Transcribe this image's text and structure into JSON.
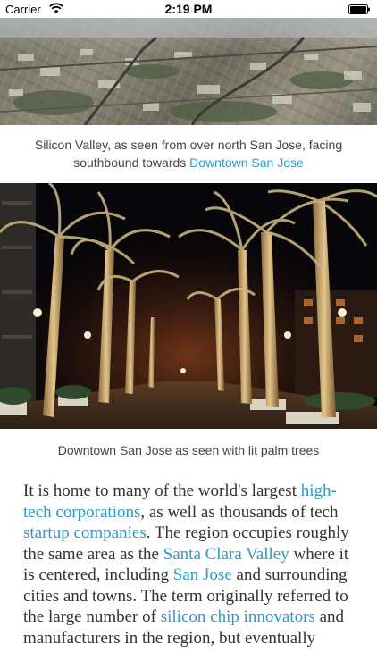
{
  "status_bar": {
    "carrier": "Carrier",
    "time": "2:19 PM"
  },
  "figure1": {
    "caption_text": "Silicon Valley, as seen from over north San Jose, facing southbound towards ",
    "caption_link": "Downtown San Jose"
  },
  "figure2": {
    "caption": "Downtown San Jose as seen with lit palm trees"
  },
  "article": {
    "t1": "It is home to many of the world's largest ",
    "l1": "high-tech corporations",
    "t2": ", as well as thousands of tech ",
    "l2": "startup companies",
    "t3": ". The region occupies roughly the same area as the ",
    "l3": "Santa Clara Valley",
    "t4": " where it is centered, including ",
    "l4": "San Jose",
    "t5": " and surrounding cities and towns. The term originally referred to the large number of ",
    "l5": "silicon chip innovators",
    "t6": " and manufacturers in the region, but eventually"
  },
  "colors": {
    "link": "#2a9ad1",
    "caption_text": "#444444",
    "body_text": "#333333"
  }
}
